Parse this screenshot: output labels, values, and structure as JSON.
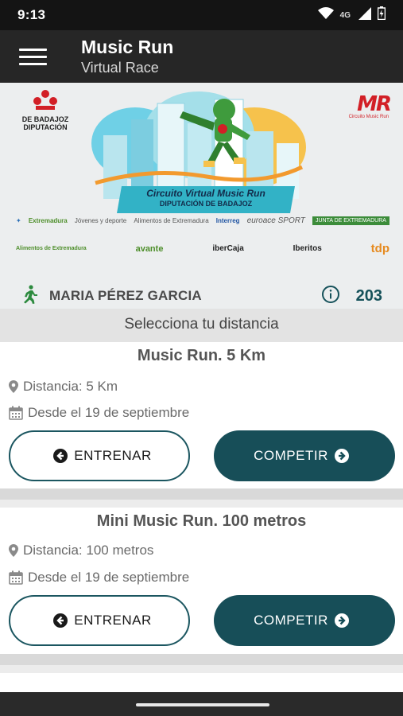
{
  "status_bar": {
    "time": "9:13",
    "network": "4G"
  },
  "app_bar": {
    "title": "Music Run",
    "subtitle": "Virtual Race"
  },
  "banner": {
    "logo_left_line1": "DE BADAJOZ",
    "logo_left_line2": "DIPUTACIÓN",
    "logo_right": "MR",
    "logo_right_sub": "Circuito Music Run",
    "race_title_line1": "Circuito Virtual Music Run",
    "race_title_line2": "DIPUTACIÓN DE BADAJOZ",
    "sponsors_row1": [
      "Extremadura",
      "Jóvenes y deporte",
      "Alimentos de Extremadura",
      "Interreg",
      "euroace SPORT",
      "JUNTA DE EXTREMADURA"
    ],
    "sponsors_row2": [
      "Alimentos de Extremadura",
      "avante",
      "iberCaja",
      "Iberitos",
      "tdp"
    ]
  },
  "runner": {
    "name": "MARIA PÉREZ GARCIA",
    "count": "203"
  },
  "select_label": "Selecciona tu distancia",
  "races": [
    {
      "title": "Music Run. 5 Km",
      "distance": "Distancia: 5 Km",
      "date": "Desde el 19 de septiembre",
      "train_label": "ENTRENAR",
      "compete_label": "COMPETIR"
    },
    {
      "title": "Mini Music Run. 100 metros",
      "distance": "Distancia: 100 metros",
      "date": "Desde el 19 de septiembre",
      "train_label": "ENTRENAR",
      "compete_label": "COMPETIR"
    }
  ],
  "colors": {
    "accent": "#174e58",
    "app_bar": "#262626",
    "status_bar": "#141414",
    "count": "#15515a"
  }
}
